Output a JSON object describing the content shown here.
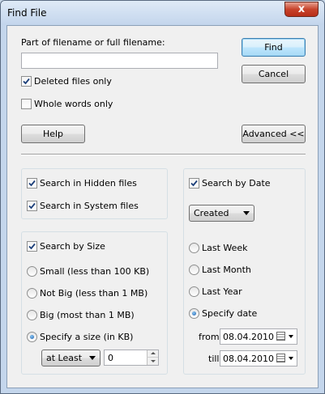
{
  "window": {
    "title": "Find File",
    "close_glyph": "x"
  },
  "filename": {
    "label": "Part of filename or full filename:",
    "value": ""
  },
  "options": {
    "deleted_only": {
      "label": "Deleted files only",
      "checked": true
    },
    "whole_words": {
      "label": "Whole words only",
      "checked": false
    }
  },
  "buttons": {
    "find": "Find",
    "cancel": "Cancel",
    "help": "Help",
    "advanced": "Advanced <<"
  },
  "hidden_system": {
    "hidden": {
      "label": "Search in Hidden files",
      "checked": true
    },
    "system": {
      "label": "Search in System files",
      "checked": true
    }
  },
  "size": {
    "enable": {
      "label": "Search by Size",
      "checked": true
    },
    "small": "Small (less than 100 KB)",
    "not_big": "Not Big (less than 1 MB)",
    "big": "Big (most than 1 MB)",
    "specify": "Specify a size (in KB)",
    "selected": "specify",
    "comparator": "at Least",
    "value": "0"
  },
  "date": {
    "enable": {
      "label": "Search by Date",
      "checked": true
    },
    "type": "Created",
    "last_week": "Last Week",
    "last_month": "Last Month",
    "last_year": "Last Year",
    "specify": "Specify date",
    "selected": "specify",
    "from_label": "from",
    "from_value": "08.04.2010",
    "till_label": "till",
    "till_value": "08.04.2010"
  },
  "icons": {
    "check": "checkmark-icon",
    "calendar": "calendar-icon"
  }
}
